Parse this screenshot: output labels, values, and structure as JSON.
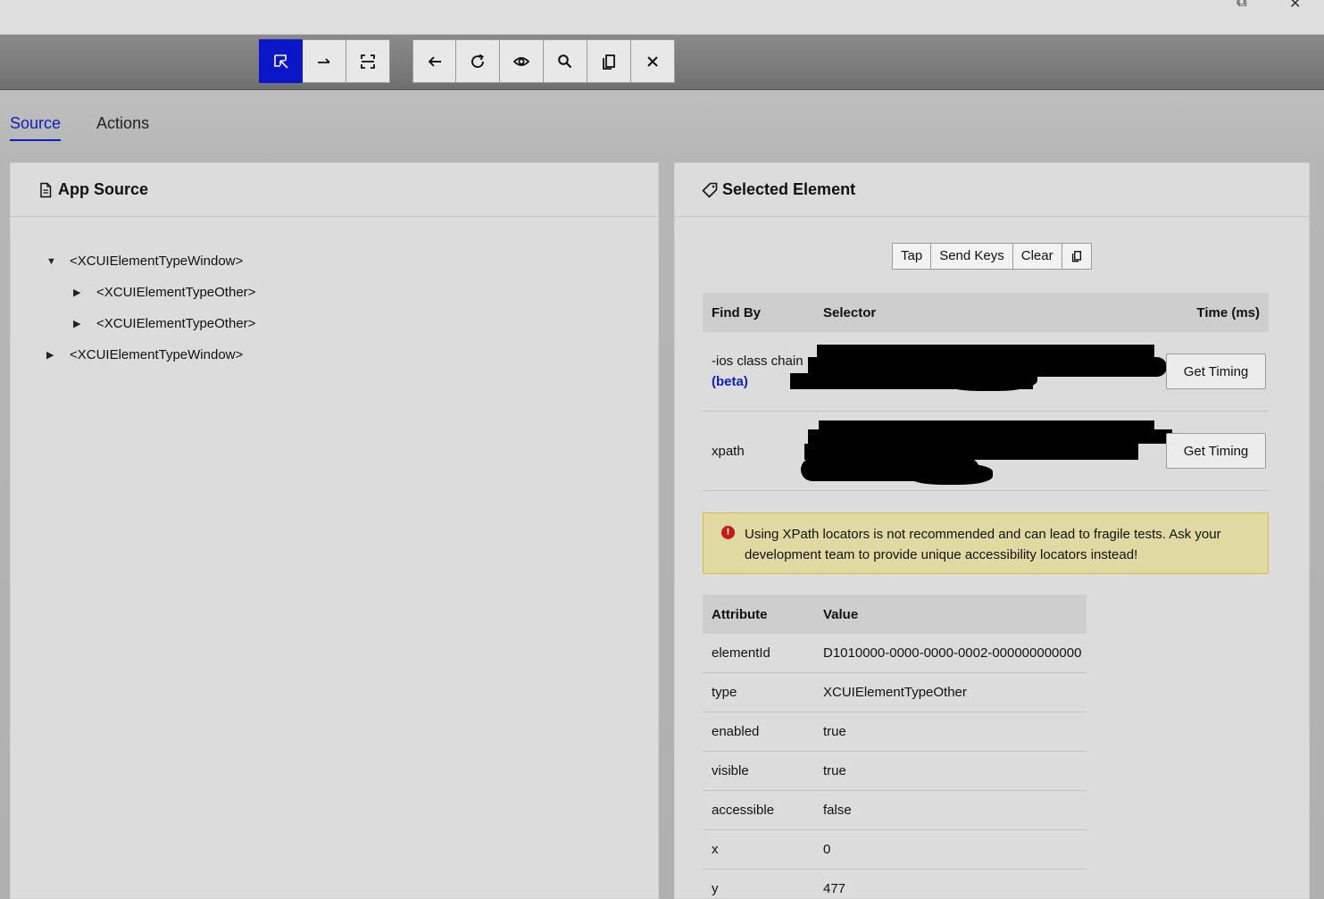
{
  "window": {
    "restore_glyph": "⧉",
    "close_glyph": "✕"
  },
  "toolbar": {
    "group1": [
      {
        "name": "select-element",
        "icon": "select-cursor-icon",
        "active": true
      },
      {
        "name": "swipe",
        "icon": "swipe-arrow-icon",
        "active": false
      },
      {
        "name": "tap-coordinates",
        "icon": "tap-frame-icon",
        "active": false
      }
    ],
    "group2": [
      {
        "name": "back",
        "icon": "arrow-left-icon"
      },
      {
        "name": "refresh",
        "icon": "refresh-icon"
      },
      {
        "name": "recorder",
        "icon": "eye-icon"
      },
      {
        "name": "search",
        "icon": "search-icon"
      },
      {
        "name": "copy-xml",
        "icon": "copy-icon"
      },
      {
        "name": "quit-session",
        "icon": "close-icon"
      }
    ]
  },
  "tabs": [
    {
      "label": "Source",
      "active": true
    },
    {
      "label": "Actions",
      "active": false
    }
  ],
  "app_source": {
    "title": "App Source",
    "tree": [
      {
        "label": "<XCUIElementTypeWindow>",
        "expanded": true,
        "depth": 0
      },
      {
        "label": "<XCUIElementTypeOther>",
        "expanded": false,
        "depth": 1
      },
      {
        "label": "<XCUIElementTypeOther>",
        "expanded": false,
        "depth": 1
      },
      {
        "label": "<XCUIElementTypeWindow>",
        "expanded": false,
        "depth": 0
      }
    ]
  },
  "selected_element": {
    "title": "Selected Element",
    "actions": {
      "tap": "Tap",
      "send_keys": "Send Keys",
      "clear": "Clear"
    },
    "selectors_header": {
      "find_by": "Find By",
      "selector": "Selector",
      "time": "Time (ms)"
    },
    "selectors": [
      {
        "find_by": "-ios class chain",
        "badge": "(beta)",
        "button": "Get Timing"
      },
      {
        "find_by": "xpath",
        "badge": "",
        "button": "Get Timing"
      }
    ],
    "warning": "Using XPath locators is not recommended and can lead to fragile tests. Ask your development team to provide unique accessibility locators instead!",
    "warning_icon": "!",
    "attributes_header": {
      "attribute": "Attribute",
      "value": "Value"
    },
    "attributes": [
      {
        "name": "elementId",
        "value": "D1010000-0000-0000-0002-000000000000"
      },
      {
        "name": "type",
        "value": "XCUIElementTypeOther"
      },
      {
        "name": "enabled",
        "value": "true"
      },
      {
        "name": "visible",
        "value": "true"
      },
      {
        "name": "accessible",
        "value": "false"
      },
      {
        "name": "x",
        "value": "0"
      },
      {
        "name": "y",
        "value": "477"
      }
    ]
  },
  "colors": {
    "accent": "#0d1fb8",
    "active_button": "#0a16c8",
    "warning_bg": "#e0d9a2",
    "error": "#c31a1a"
  }
}
